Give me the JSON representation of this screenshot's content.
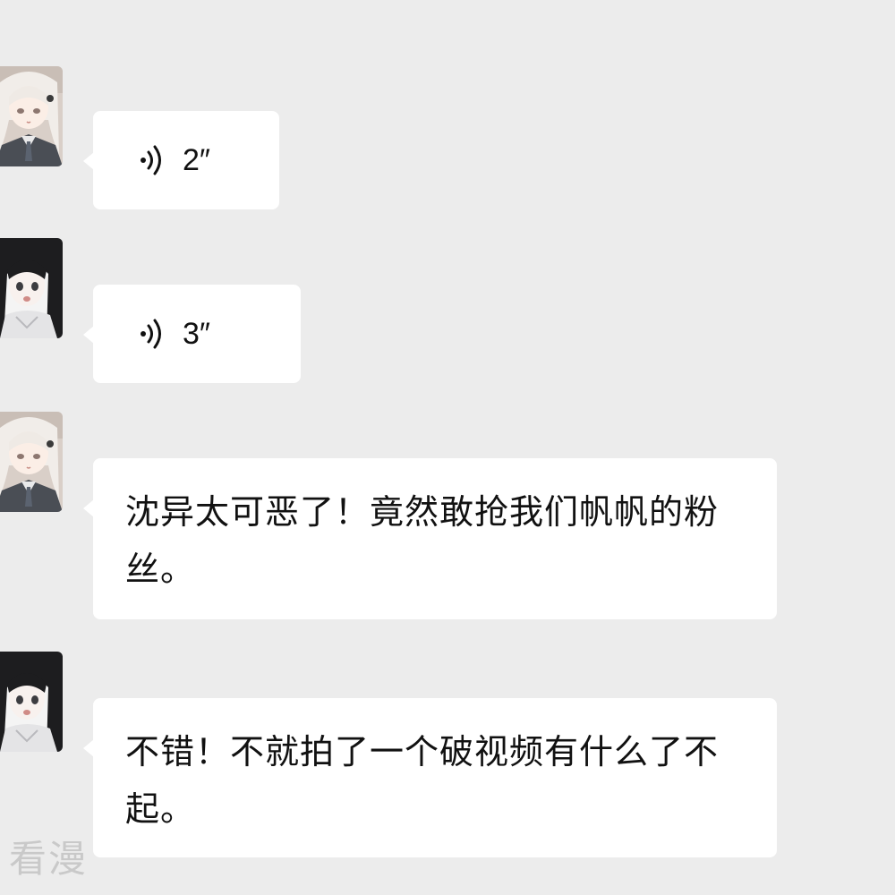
{
  "messages": [
    {
      "sender": "white-hair-girl",
      "type": "voice",
      "duration": "2″"
    },
    {
      "sender": "black-hair-girl",
      "type": "voice",
      "duration": "3″"
    },
    {
      "sender": "white-hair-girl",
      "type": "text",
      "text": "沈异太可恶了！竟然敢抢我们帆帆的粉丝。"
    },
    {
      "sender": "black-hair-girl",
      "type": "text",
      "text": "不错！不就拍了一个破视频有什么了不起。"
    }
  ],
  "watermark": "看漫",
  "colors": {
    "background": "#ececec",
    "bubble": "#ffffff",
    "text": "#111111"
  },
  "icons": {
    "voice": "voice-wave-icon",
    "avatar_a": "white-hair-girl-avatar",
    "avatar_b": "black-hair-girl-avatar"
  }
}
